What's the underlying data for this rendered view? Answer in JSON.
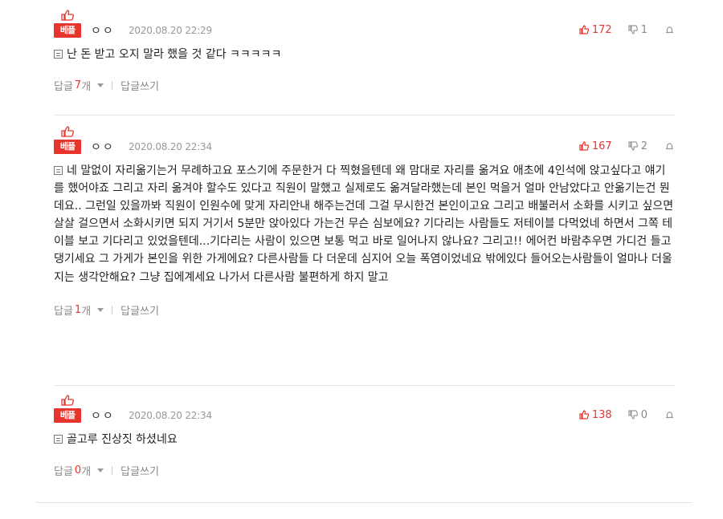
{
  "comments": [
    {
      "badge": "베플",
      "nickname": "ㅇㅇ",
      "date": "2020.08.20 22:29",
      "upvotes": "172",
      "downvotes": "1",
      "text": "난 돈 받고 오지 말라 했을 것 같다 ㅋㅋㅋㅋㅋ",
      "reply_label": "답글",
      "reply_count": "7",
      "reply_unit": "개",
      "write_label": "답글쓰기"
    },
    {
      "badge": "베플",
      "nickname": "ㅇㅇ",
      "date": "2020.08.20 22:34",
      "upvotes": "167",
      "downvotes": "2",
      "text": "네 말없이 자리옮기는거 무례하고요 포스기에 주문한거 다 찍혔을텐데 왜 맘대로 자리를 옮겨요 애초에 4인석에 앉고싶다고 얘기를 했어야죠 그리고 자리 옮겨야 할수도 있다고 직원이 말했고 실제로도 옮겨달라했는데 본인 먹을거 얼마 안남았다고 안옮기는건 뭔데요.. 그런일 있을까봐 직원이 인원수에 맞게 자리안내 해주는건데 그걸 무시한건 본인이고요 그리고 배불러서 소화를 시키고 싶으면 살살 걸으면서 소화시키면 되지 거기서 5분만 앉아있다 가는건 무슨 심보에요? 기다리는 사람들도 저테이블 다먹었네 하면서 그쪽 테이블 보고 기다리고 있었을텐데...기다리는 사람이 있으면 보통 먹고 바로 일어나지 않나요? 그리고!! 에어컨 바람추우면 가디건 들고댕기세요 그 가게가 본인을 위한 가게에요? 다른사람들 다 더운데 심지어 오늘 폭염이었네요 밖에있다 들어오는사람들이 얼마나 더울지는 생각안해요? 그냥 집에계세요 나가서 다른사람 불편하게 하지 말고",
      "reply_label": "답글",
      "reply_count": "1",
      "reply_unit": "개",
      "write_label": "답글쓰기"
    },
    {
      "badge": "베플",
      "nickname": "ㅇㅇ",
      "date": "2020.08.20 22:34",
      "upvotes": "138",
      "downvotes": "0",
      "text": "골고루 진상짓 하셨네요",
      "reply_label": "답글",
      "reply_count": "0",
      "reply_unit": "개",
      "write_label": "답글쓰기"
    }
  ],
  "colors": {
    "accent": "#e8342f",
    "muted": "#888888",
    "divider": "#e6e6e6"
  },
  "icons": {
    "best": "thumbs-up-icon",
    "up": "thumbs-up-icon",
    "down": "thumbs-down-icon",
    "report": "siren-icon",
    "comment": "comment-icon",
    "toggle": "caret-down-icon"
  }
}
